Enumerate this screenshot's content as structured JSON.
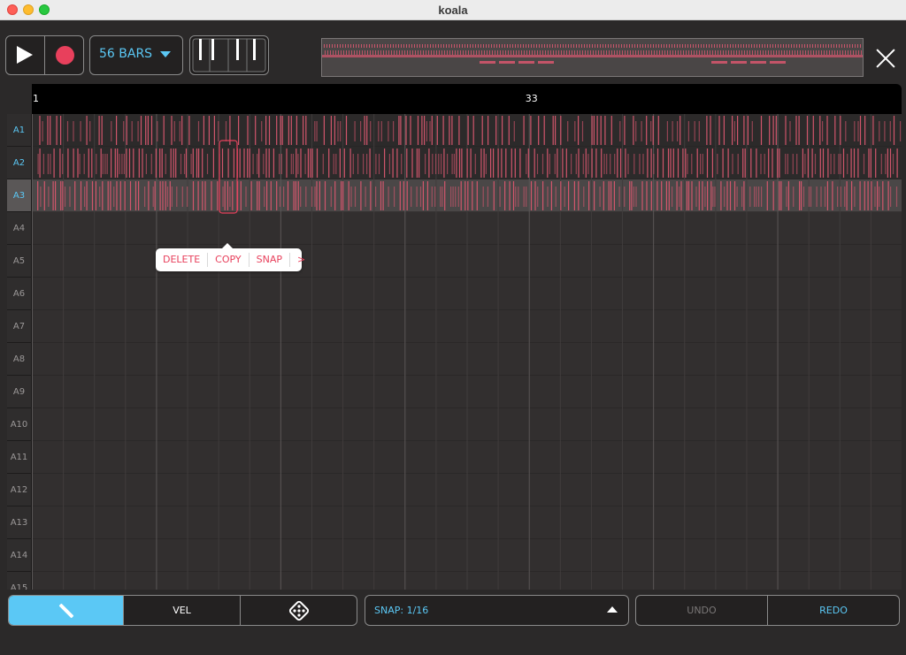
{
  "window": {
    "title": "koala"
  },
  "toolbar": {
    "bars_label": "56 BARS"
  },
  "ruler": {
    "labels": [
      {
        "bar": 1,
        "text": "1"
      },
      {
        "bar": 33,
        "text": "33"
      }
    ],
    "total_bars": 56
  },
  "tracks": [
    {
      "label": "A1",
      "state": "active"
    },
    {
      "label": "A2",
      "state": "active"
    },
    {
      "label": "A3",
      "state": "selected"
    },
    {
      "label": "A4",
      "state": "empty"
    },
    {
      "label": "A5",
      "state": "empty"
    },
    {
      "label": "A6",
      "state": "empty"
    },
    {
      "label": "A7",
      "state": "empty"
    },
    {
      "label": "A8",
      "state": "empty"
    },
    {
      "label": "A9",
      "state": "empty"
    },
    {
      "label": "A10",
      "state": "empty"
    },
    {
      "label": "A11",
      "state": "empty"
    },
    {
      "label": "A12",
      "state": "empty"
    },
    {
      "label": "A13",
      "state": "empty"
    },
    {
      "label": "A14",
      "state": "empty"
    },
    {
      "label": "A15",
      "state": "empty"
    }
  ],
  "popup": {
    "items": [
      "DELETE",
      "COPY",
      "SNAP",
      ">"
    ]
  },
  "bottom": {
    "vel_label": "VEL",
    "snap_label": "SNAP: 1/16",
    "undo_label": "UNDO",
    "redo_label": "REDO"
  },
  "colors": {
    "accent": "#5bc8f5",
    "note": "#d9576f",
    "record": "#e8405c"
  }
}
